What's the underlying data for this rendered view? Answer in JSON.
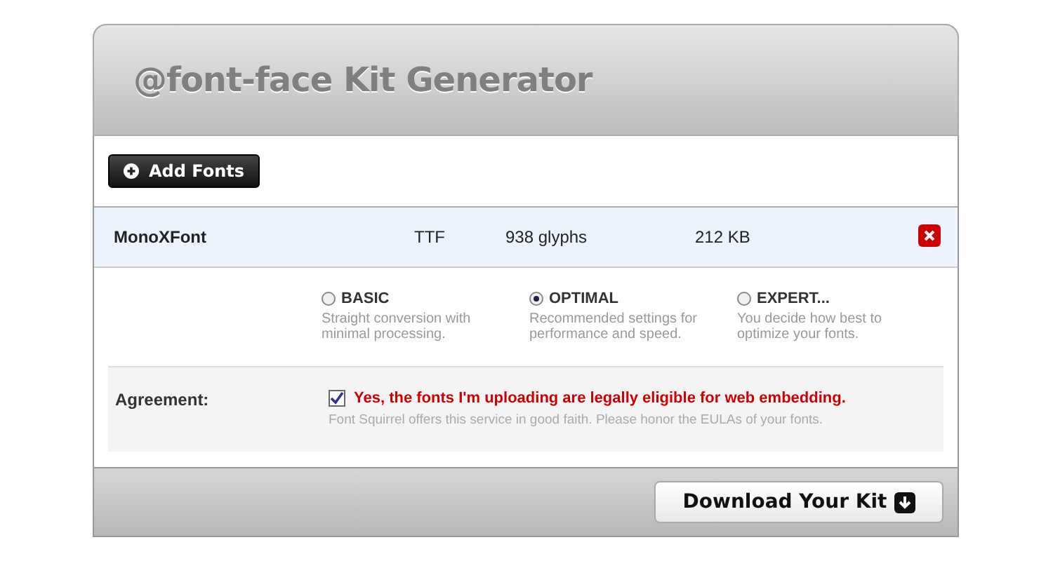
{
  "header": {
    "title": "@font-face Kit Generator"
  },
  "add_button": {
    "label": "Add Fonts"
  },
  "fonts": [
    {
      "name": "MonoXFont",
      "format": "TTF",
      "glyphs": "938 glyphs",
      "size": "212 KB"
    }
  ],
  "modes": [
    {
      "label": "BASIC",
      "description": "Straight conversion with minimal processing.",
      "selected": false
    },
    {
      "label": "OPTIMAL",
      "description": "Recommended settings for performance and speed.",
      "selected": true
    },
    {
      "label": "EXPERT...",
      "description": "You decide how best to optimize your fonts.",
      "selected": false
    }
  ],
  "agreement": {
    "label": "Agreement:",
    "checked": true,
    "statement": "Yes, the fonts I'm uploading are legally eligible for web embedding.",
    "note": "Font Squirrel offers this service in good faith. Please honor the EULAs of your fonts."
  },
  "download_button": {
    "label": "Download Your Kit"
  }
}
